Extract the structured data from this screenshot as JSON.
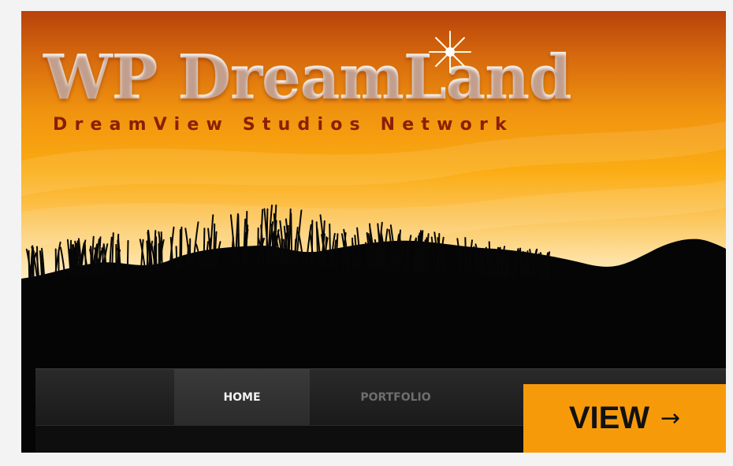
{
  "hero": {
    "title": "WP DreamLand",
    "subtitle": "DreamView Studios Network"
  },
  "nav": {
    "items": [
      {
        "label": "HOME",
        "active": true
      },
      {
        "label": "PORTFOLIO",
        "active": false
      }
    ]
  },
  "cta": {
    "label": "VIEW",
    "icon": "arrow-right-icon",
    "arrow": "→",
    "color": "#f79a0a"
  },
  "colors": {
    "page_background": "#f3f3f3",
    "sky_top": "#b8410a",
    "sky_mid": "#fbac12",
    "subtitle": "#8a1f05",
    "nav_background": "#1a1a1a"
  }
}
